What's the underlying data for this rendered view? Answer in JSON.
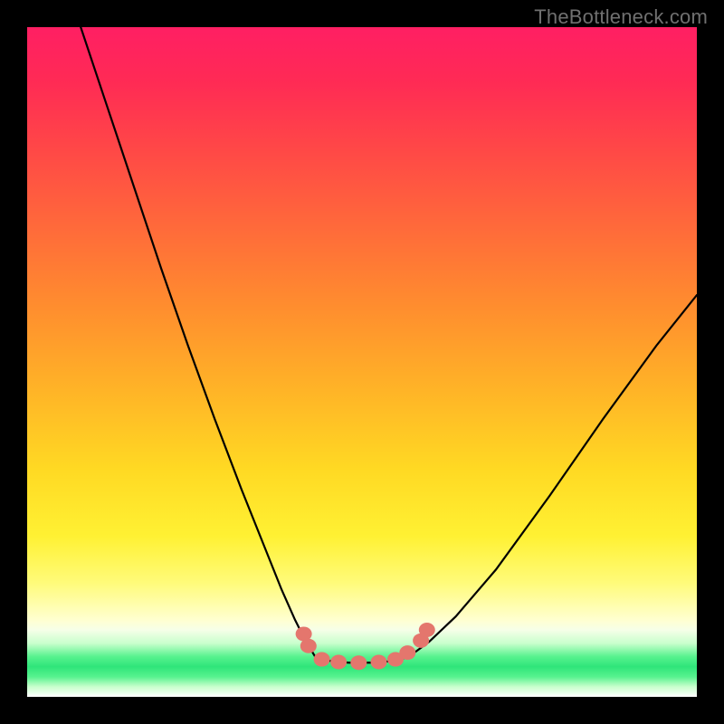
{
  "attribution": "TheBottleneck.com",
  "chart_data": {
    "type": "line",
    "title": "",
    "xlabel": "",
    "ylabel": "",
    "xlim": [
      0,
      100
    ],
    "ylim": [
      0,
      100
    ],
    "grid": false,
    "series": [
      {
        "name": "left-branch",
        "x": [
          8,
          12,
          16,
          20,
          24,
          28,
          32,
          36,
          38,
          40,
          41.5,
          43
        ],
        "y": [
          100,
          88,
          76,
          64,
          52.5,
          41.5,
          31,
          21,
          16,
          11.5,
          8.5,
          6
        ]
      },
      {
        "name": "valley-flat",
        "x": [
          43,
          45,
          48,
          52,
          55,
          57
        ],
        "y": [
          6,
          5.4,
          5.1,
          5.1,
          5.4,
          6
        ]
      },
      {
        "name": "right-branch",
        "x": [
          57,
          60,
          64,
          70,
          78,
          86,
          94,
          100
        ],
        "y": [
          6,
          8.2,
          12,
          19,
          30,
          41.5,
          52.5,
          60
        ]
      },
      {
        "name": "beads",
        "type": "scatter",
        "x": [
          41.3,
          42.0,
          44.0,
          46.5,
          49.5,
          52.5,
          55.0,
          56.8,
          58.8,
          59.7
        ],
        "y": [
          9.4,
          7.6,
          5.6,
          5.2,
          5.1,
          5.2,
          5.6,
          6.6,
          8.4,
          10.0
        ]
      }
    ],
    "colors": {
      "curve": "#000000",
      "beads": "#e4766d"
    }
  }
}
